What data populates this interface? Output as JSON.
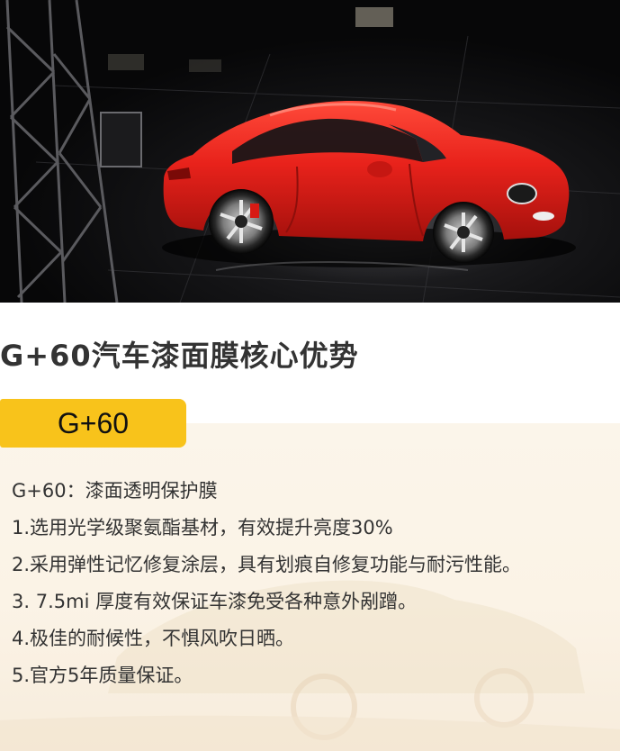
{
  "hero": {
    "image_subject": "red-sports-car-photo"
  },
  "title": "G+60汽车漆面膜核心优势",
  "badge": "G+60",
  "features": [
    "G+60：漆面透明保护膜",
    "1.选用光学级聚氨酯基材，有效提升亮度30%",
    "2.采用弹性记忆修复涂层，具有划痕自修复功能与耐污性能。",
    "3. 7.5mi 厚度有效保证车漆免受各种意外剐蹭。",
    "4.极佳的耐候性，不惧风吹日晒。",
    "5.官方5年质量保证。"
  ],
  "colors": {
    "badge": "#f8c31b",
    "title_text": "#333333",
    "body_text": "#333333",
    "panel_bg": "#fbf4e8",
    "car_red": "#e8221b"
  }
}
